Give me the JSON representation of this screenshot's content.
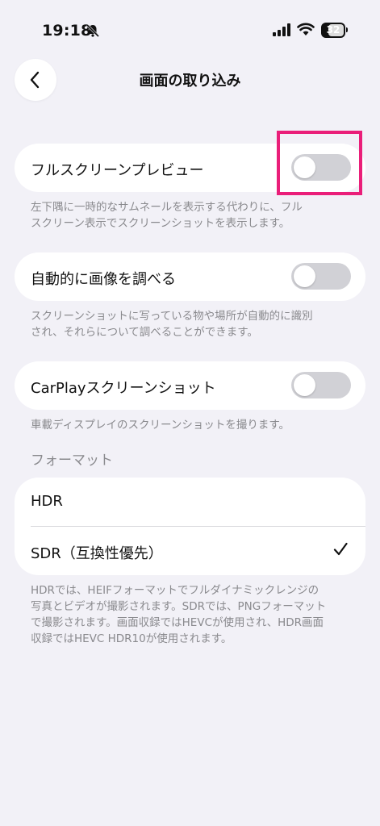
{
  "status_bar": {
    "time": "19:18",
    "battery": "32"
  },
  "header": {
    "title": "画面の取り込み"
  },
  "settings": {
    "fullscreen_preview": {
      "label": "フルスクリーンプレビュー",
      "description_line1": "左下隅に一時的なサムネールを表示する代わりに、フル",
      "description_line2": "スクリーン表示でスクリーンショットを表示します。",
      "enabled": false
    },
    "auto_lookup": {
      "label": "自動的に画像を調べる",
      "description_line1": "スクリーンショットに写っている物や場所が自動的に識別",
      "description_line2": "され、それらについて調べることができます。",
      "enabled": false
    },
    "carplay": {
      "label": "CarPlayスクリーンショット",
      "description": "車載ディスプレイのスクリーンショットを撮ります。",
      "enabled": false
    }
  },
  "format": {
    "header": "フォーマット",
    "options": [
      {
        "label": "HDR",
        "selected": false
      },
      {
        "label": "SDR（互換性優先）",
        "selected": true
      }
    ],
    "description_lines": [
      "HDRでは、HEIFフォーマットでフルダイナミックレンジの",
      "写真とビデオが撮影されます。SDRでは、PNGフォーマット",
      "で撮影されます。画面収録ではHEVCが使用され、HDR画面",
      "収録ではHEVC HDR10が使用されます。"
    ]
  },
  "colors": {
    "background": "#f2f1f7",
    "toggle_off": "#d1d1d6",
    "highlight": "#ea1e79"
  }
}
